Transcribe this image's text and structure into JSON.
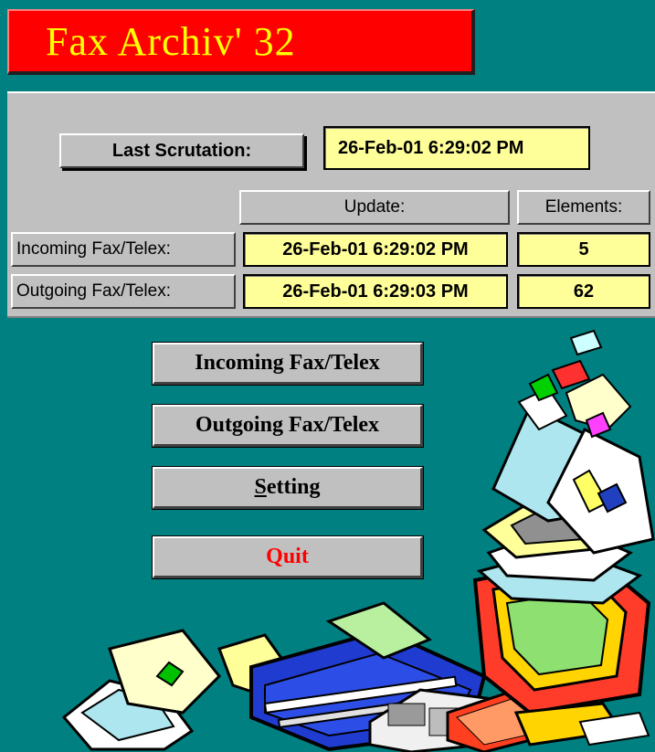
{
  "window": {
    "title": "Fax Archiv' 32"
  },
  "status": {
    "last_scrutation_label": "Last Scrutation:",
    "last_scrutation_value": "26-Feb-01 6:29:02 PM"
  },
  "table": {
    "columns": [
      "Update:",
      "Elements:"
    ],
    "rows": [
      {
        "label": "Incoming Fax/Telex:",
        "update": "26-Feb-01 6:29:02 PM",
        "elements": "5"
      },
      {
        "label": "Outgoing Fax/Telex:",
        "update": "26-Feb-01 6:29:03 PM",
        "elements": "62"
      }
    ]
  },
  "menu": {
    "incoming_label": "Incoming Fax/Telex",
    "outgoing_label": "Outgoing Fax/Telex",
    "setting_accel": "S",
    "setting_rest": "etting",
    "quit_label": "Quit"
  },
  "illustration": {
    "icon": "fax-and-computer-clipart-icon"
  },
  "colors": {
    "background": "#008080",
    "panel": "#c0c0c0",
    "banner": "#ff0000",
    "title_text": "#ffff00",
    "field": "#ffff99",
    "quit_text": "#ff0000"
  }
}
